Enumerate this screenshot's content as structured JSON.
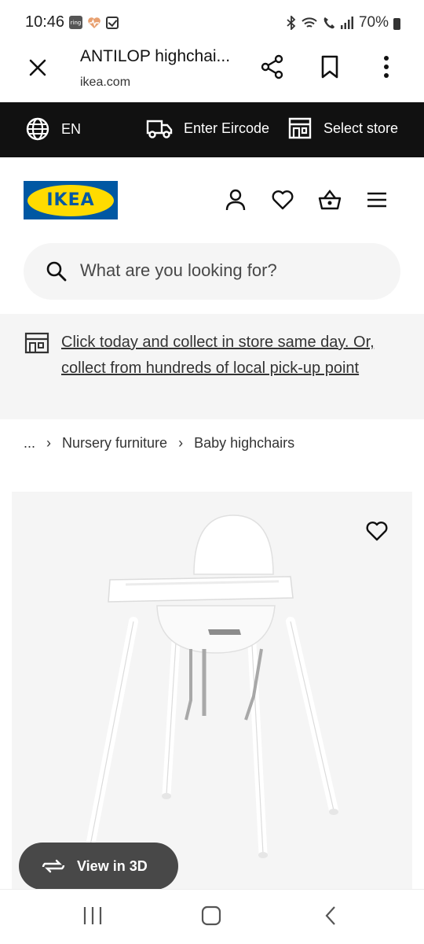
{
  "status": {
    "time": "10:46",
    "left_icons": [
      "ring-icon",
      "health-heart-icon",
      "checkbox-icon"
    ],
    "battery": "70%",
    "right_icons": [
      "bluetooth-icon",
      "wifi-icon",
      "wifi-calling-icon",
      "signal-icon",
      "battery-icon"
    ]
  },
  "browser": {
    "title": "ANTILOP highchai...",
    "url": "ikea.com",
    "actions": [
      "share-icon",
      "bookmark-icon",
      "more-options-icon"
    ]
  },
  "utility_bar": {
    "language": "EN",
    "eircode": "Enter Eircode",
    "store": "Select store"
  },
  "header": {
    "logo_text": "IKEA",
    "brand_colors": {
      "blue": "#0058a3",
      "yellow": "#ffdb00"
    }
  },
  "search": {
    "placeholder": "What are you looking for?"
  },
  "banner": {
    "text": "Click today and collect in store same day. Or, collect from hundreds of local pick-up point"
  },
  "breadcrumb": {
    "items": [
      "...",
      "Nursery furniture",
      "Baby highchairs"
    ]
  },
  "product": {
    "view_3d_label": "View in 3D"
  },
  "colors": {
    "black_bar": "#111111",
    "panel_grey": "#f5f5f5",
    "pill_dark": "#484848"
  }
}
